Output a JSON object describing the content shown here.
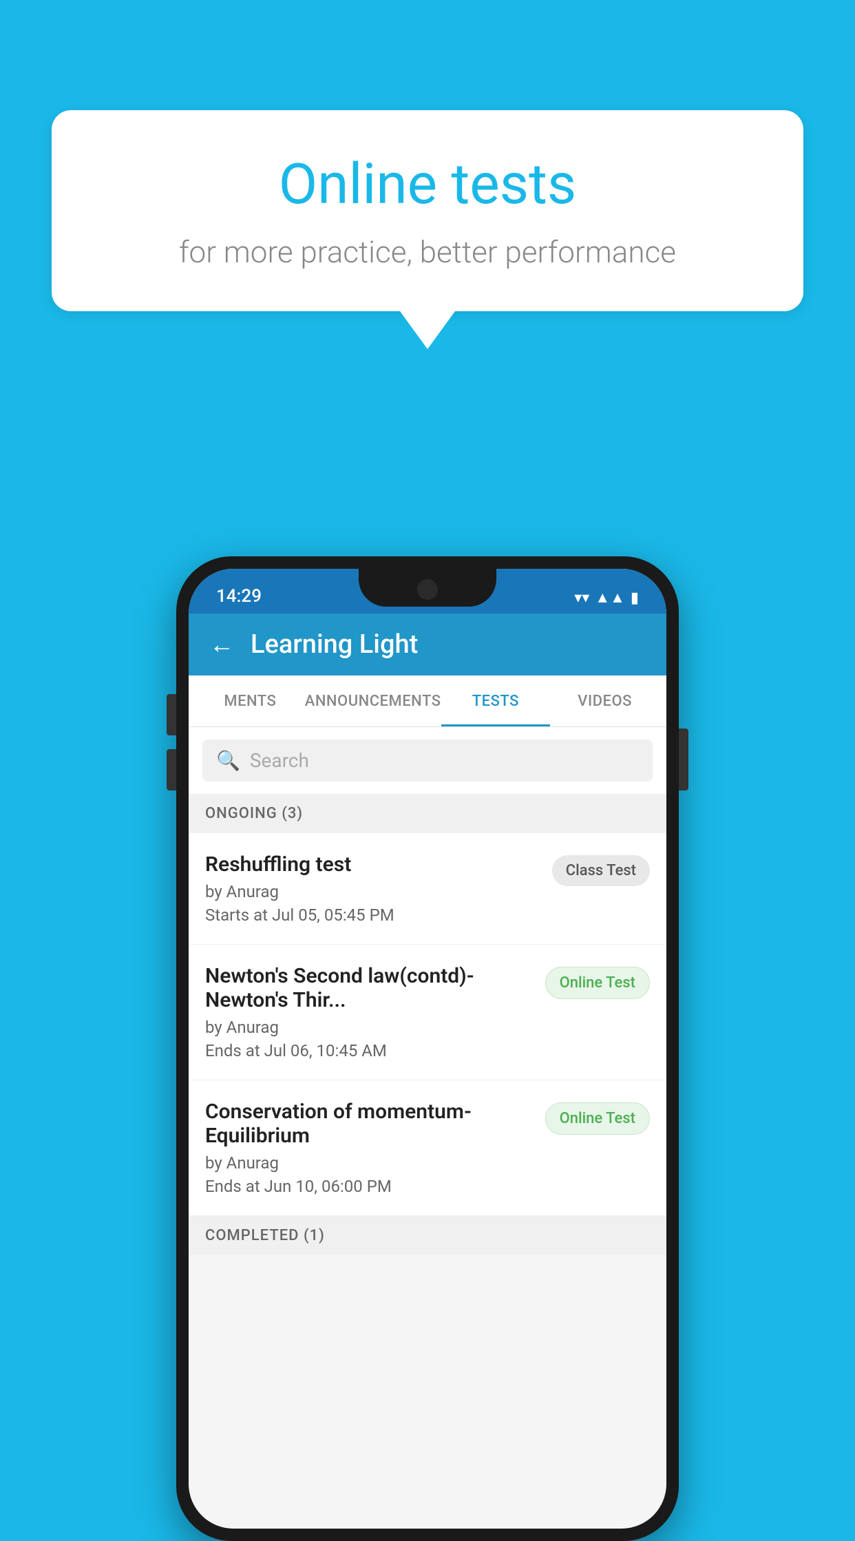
{
  "background_color": "#1ab8e8",
  "speech_bubble": {
    "title": "Online tests",
    "subtitle": "for more practice, better performance"
  },
  "phone": {
    "status_bar": {
      "time": "14:29",
      "wifi_icon": "▼",
      "signal_icon": "▲",
      "battery_icon": "▮"
    },
    "header": {
      "back_label": "←",
      "title": "Learning Light"
    },
    "tabs": [
      {
        "label": "MENTS",
        "active": false
      },
      {
        "label": "ANNOUNCEMENTS",
        "active": false
      },
      {
        "label": "TESTS",
        "active": true
      },
      {
        "label": "VIDEOS",
        "active": false
      }
    ],
    "search": {
      "placeholder": "Search"
    },
    "ongoing_section": {
      "label": "ONGOING (3)"
    },
    "tests": [
      {
        "title": "Reshuffling test",
        "author": "by Anurag",
        "time_label": "Starts at",
        "time": "Jul 05, 05:45 PM",
        "badge": "Class Test",
        "badge_type": "class"
      },
      {
        "title": "Newton's Second law(contd)-Newton's Thir...",
        "author": "by Anurag",
        "time_label": "Ends at",
        "time": "Jul 06, 10:45 AM",
        "badge": "Online Test",
        "badge_type": "online"
      },
      {
        "title": "Conservation of momentum-Equilibrium",
        "author": "by Anurag",
        "time_label": "Ends at",
        "time": "Jun 10, 06:00 PM",
        "badge": "Online Test",
        "badge_type": "online"
      }
    ],
    "completed_section": {
      "label": "COMPLETED (1)"
    }
  }
}
